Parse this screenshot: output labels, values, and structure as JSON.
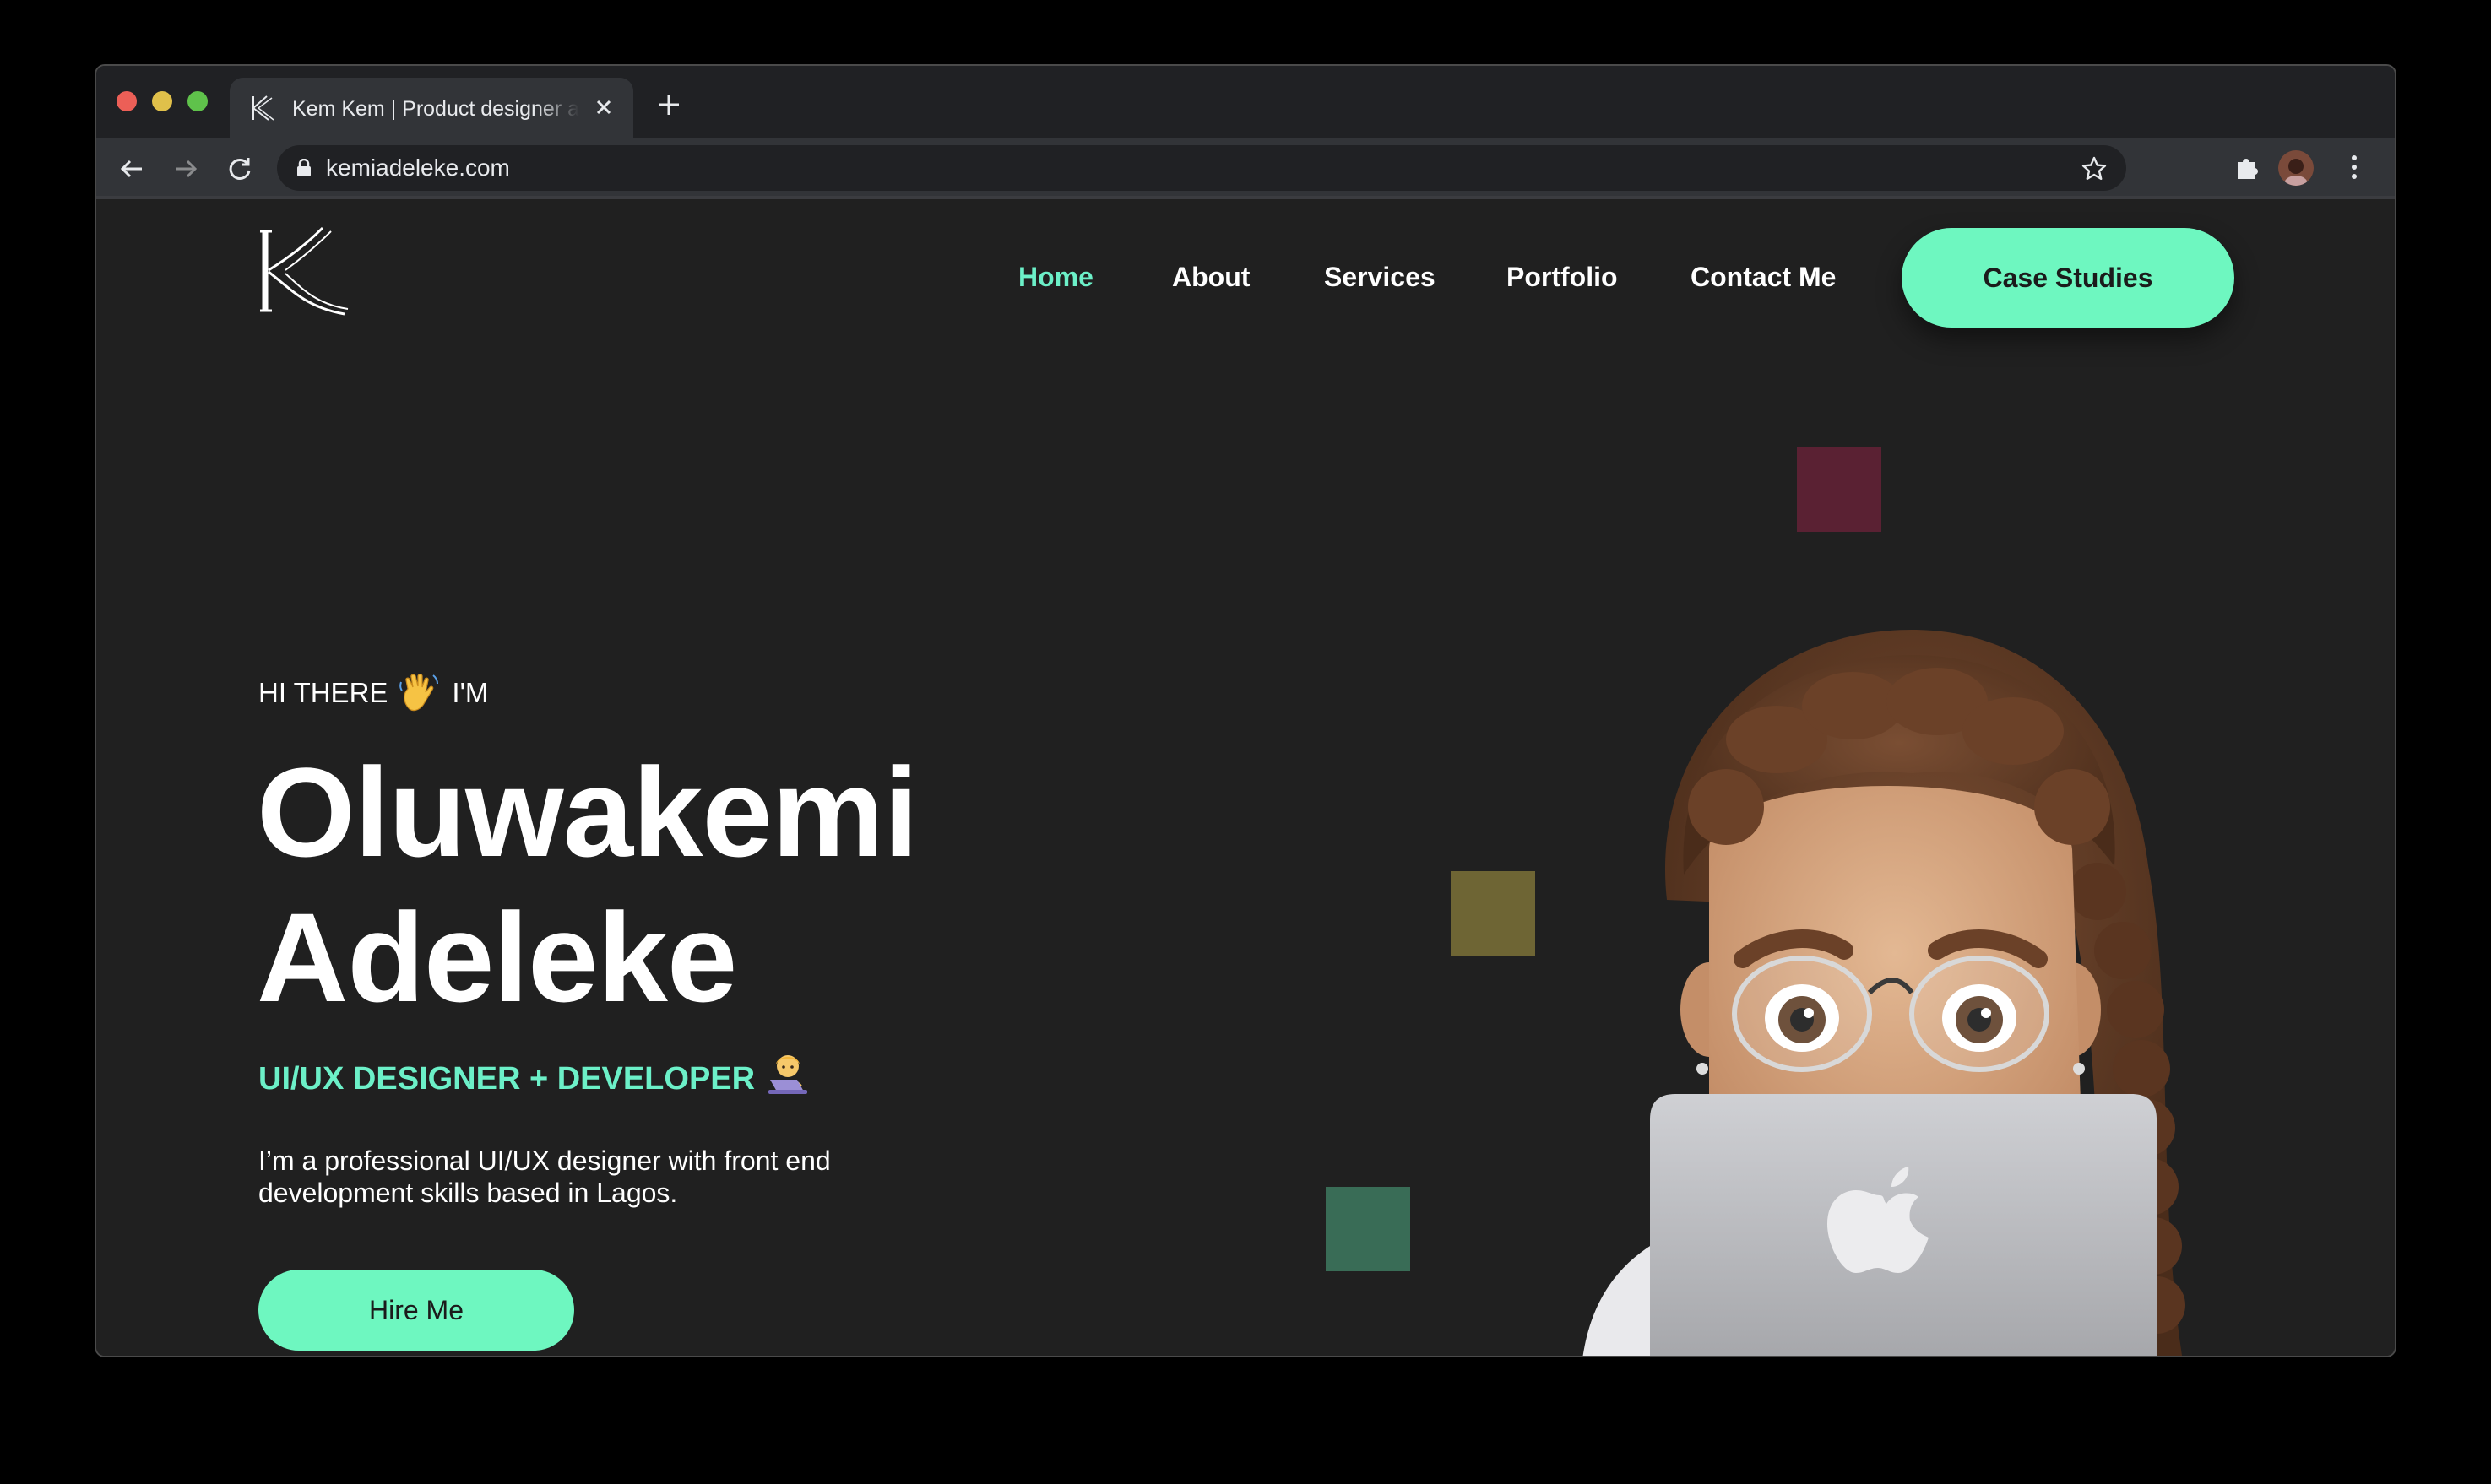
{
  "browser": {
    "tab_title": "Kem Kem | Product designer and developer",
    "url": "kemiadeleke.com"
  },
  "nav": {
    "items": [
      "Home",
      "About",
      "Services",
      "Portfolio",
      "Contact Me"
    ],
    "active": "Home",
    "cta": "Case Studies"
  },
  "hero": {
    "greeting_pre": "HI THERE",
    "greeting_post": "I'M",
    "first_name": "Oluwakemi",
    "last_name": "Adeleke",
    "role": "UI/UX DESIGNER + DEVELOPER",
    "intro": "I’m a professional UI/UX designer with front end development skills based in Lagos.",
    "button": "Hire Me"
  },
  "colors": {
    "accent": "#6ef7c0",
    "active_link": "#6cf0c8",
    "page_bg": "#202020",
    "square_maroon": "#5a2133",
    "square_olive": "#6e6534",
    "square_green": "#396c56"
  },
  "icons": [
    "k-logo-icon",
    "waving-hand-icon",
    "technologist-emoji-icon",
    "lock-icon",
    "star-icon",
    "extensions-icon",
    "menu-icon",
    "back-icon",
    "forward-icon",
    "reload-icon",
    "close-icon",
    "plus-icon"
  ]
}
